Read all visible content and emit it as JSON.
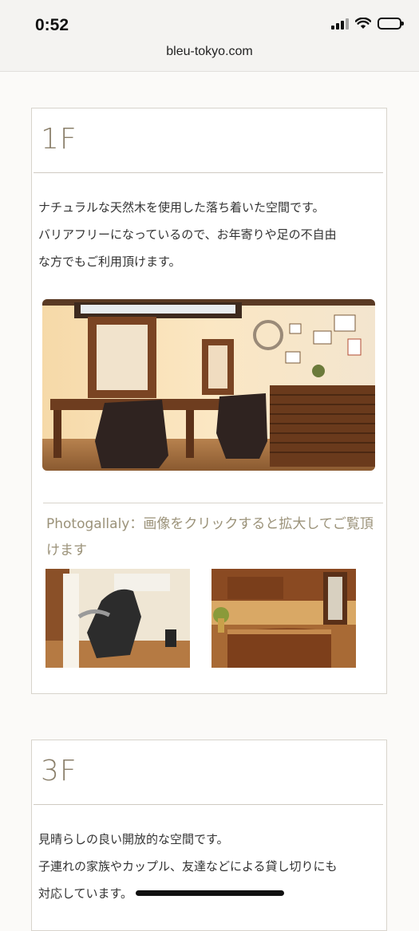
{
  "status_bar": {
    "time": "0:52",
    "url": "bleu-tokyo.com"
  },
  "floor_1": {
    "title": "1F",
    "description": [
      "ナチュラルな天然木を使用した落ち着いた空間です。",
      "バリアフリーになっているので、お年寄りや足の不自由",
      "な方でもご利用頂けます。"
    ],
    "main_photo": "salon-interior-mirrors-photo",
    "gallery_caption": "Photogallaly：画像をクリックすると拡大してご覧頂けます",
    "thumbnails": [
      "shampoo-chair-photo",
      "reception-counter-photo"
    ]
  },
  "floor_3": {
    "title": "3F",
    "description": [
      "見晴らしの良い開放的な空間です。",
      "子連れの家族やカップル、友達などによる貸し切りにも",
      "対応しています。"
    ]
  },
  "colors": {
    "heading": "#8a7f6a",
    "caption": "#9b9279",
    "wood": "#6b3a1f"
  }
}
